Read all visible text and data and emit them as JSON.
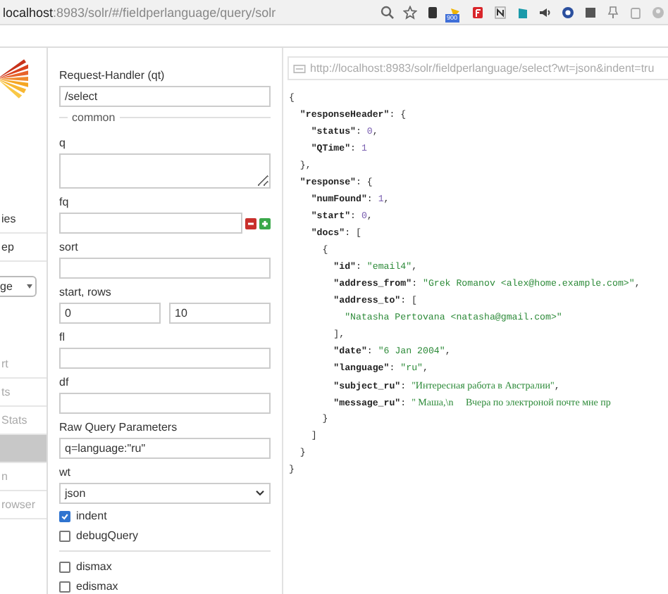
{
  "browser": {
    "url_host": "localhost",
    "url_path": ":8983/solr/#/fieldperlanguage/query/solr",
    "badge": "900"
  },
  "sidebar": {
    "menu_items": [
      {
        "label": "ies",
        "selected": false
      },
      {
        "label": "ep",
        "selected": false
      }
    ],
    "core_selector": "ge",
    "core_items": [
      {
        "label": "rt",
        "selected": false
      },
      {
        "label": "ts",
        "selected": false
      },
      {
        "label": "Stats",
        "selected": false
      },
      {
        "selected": true
      },
      {
        "label": "n",
        "selected": false
      },
      {
        "label": "rowser",
        "selected": false
      }
    ]
  },
  "form": {
    "handler": {
      "label": "Request-Handler (qt)",
      "value": "/select"
    },
    "section": "common",
    "fields": [
      {
        "kind": "textarea",
        "label": "q"
      },
      {
        "kind": "input_buttons",
        "label": "fq"
      },
      {
        "kind": "input",
        "label": "sort"
      },
      {
        "kind": "pair",
        "label": "start, rows",
        "values": [
          "0",
          "10"
        ]
      },
      {
        "kind": "input",
        "label": "fl"
      },
      {
        "kind": "input",
        "label": "df"
      },
      {
        "kind": "input",
        "label": "Raw Query Parameters",
        "value": "q=language:\"ru\""
      },
      {
        "kind": "select",
        "label": "wt",
        "value": "json"
      },
      {
        "kind": "checkbox",
        "label": "indent",
        "checked": true
      },
      {
        "kind": "checkbox",
        "label": "debugQuery",
        "checked": false
      },
      {
        "kind": "divider"
      },
      {
        "kind": "checkbox",
        "label": "dismax",
        "checked": false
      },
      {
        "kind": "checkbox",
        "label": "edismax",
        "checked": false
      }
    ]
  },
  "result": {
    "url": "http://localhost:8983/solr/fieldperlanguage/select?wt=json&indent=tru",
    "lines": [
      [
        {
          "kind": "punct",
          "text": "{"
        }
      ],
      [
        {
          "kind": "key",
          "text": "  \"responseHeader\""
        },
        {
          "kind": "punct",
          "text": ": {"
        }
      ],
      [
        {
          "kind": "key",
          "text": "    \"status\""
        },
        {
          "kind": "punct",
          "text": ": "
        },
        {
          "kind": "number",
          "text": "0"
        },
        {
          "kind": "punct",
          "text": ","
        }
      ],
      [
        {
          "kind": "key",
          "text": "    \"QTime\""
        },
        {
          "kind": "punct",
          "text": ": "
        },
        {
          "kind": "number",
          "text": "1"
        }
      ],
      [
        {
          "kind": "punct",
          "text": "  },"
        }
      ],
      [
        {
          "kind": "key",
          "text": "  \"response\""
        },
        {
          "kind": "punct",
          "text": ": {"
        }
      ],
      [
        {
          "kind": "key",
          "text": "    \"numFound\""
        },
        {
          "kind": "punct",
          "text": ": "
        },
        {
          "kind": "number",
          "text": "1"
        },
        {
          "kind": "punct",
          "text": ","
        }
      ],
      [
        {
          "kind": "key",
          "text": "    \"start\""
        },
        {
          "kind": "punct",
          "text": ": "
        },
        {
          "kind": "number",
          "text": "0"
        },
        {
          "kind": "punct",
          "text": ","
        }
      ],
      [
        {
          "kind": "key",
          "text": "    \"docs\""
        },
        {
          "kind": "punct",
          "text": ": ["
        }
      ],
      [
        {
          "kind": "punct",
          "text": "      {"
        }
      ],
      [
        {
          "kind": "key",
          "text": "        \"id\""
        },
        {
          "kind": "punct",
          "text": ": "
        },
        {
          "kind": "string",
          "text": "\"email4\""
        },
        {
          "kind": "punct",
          "text": ","
        }
      ],
      [
        {
          "kind": "key",
          "text": "        \"address_from\""
        },
        {
          "kind": "punct",
          "text": ": "
        },
        {
          "kind": "string",
          "text": "\"Grek Romanov <alex@home.example.com>\""
        },
        {
          "kind": "punct",
          "text": ","
        }
      ],
      [
        {
          "kind": "key",
          "text": "        \"address_to\""
        },
        {
          "kind": "punct",
          "text": ": ["
        }
      ],
      [
        {
          "kind": "string",
          "text": "          \"Natasha Pertovana <natasha@gmail.com>\""
        }
      ],
      [
        {
          "kind": "punct",
          "text": "        ],"
        }
      ],
      [
        {
          "kind": "key",
          "text": "        \"date\""
        },
        {
          "kind": "punct",
          "text": ": "
        },
        {
          "kind": "string",
          "text": "\"6 Jan 2004\""
        },
        {
          "kind": "punct",
          "text": ","
        }
      ],
      [
        {
          "kind": "key",
          "text": "        \"language\""
        },
        {
          "kind": "punct",
          "text": ": "
        },
        {
          "kind": "string",
          "text": "\"ru\""
        },
        {
          "kind": "punct",
          "text": ","
        }
      ],
      [
        {
          "kind": "key",
          "text": "        \"subject_ru\""
        },
        {
          "kind": "punct",
          "text": ": "
        },
        {
          "kind": "serif",
          "text": "\"Интересная работа в Австралии\""
        },
        {
          "kind": "punct",
          "text": ","
        }
      ],
      [
        {
          "kind": "key",
          "text": "        \"message_ru\""
        },
        {
          "kind": "punct",
          "text": ": "
        },
        {
          "kind": "serif",
          "text": "\" Маша,\\n     Вчера по электроной почте мне пр"
        }
      ],
      [
        {
          "kind": "punct",
          "text": "      }"
        }
      ],
      [
        {
          "kind": "punct",
          "text": "    ]"
        }
      ],
      [
        {
          "kind": "punct",
          "text": "  }"
        }
      ],
      [
        {
          "kind": "punct",
          "text": "}"
        }
      ]
    ]
  }
}
